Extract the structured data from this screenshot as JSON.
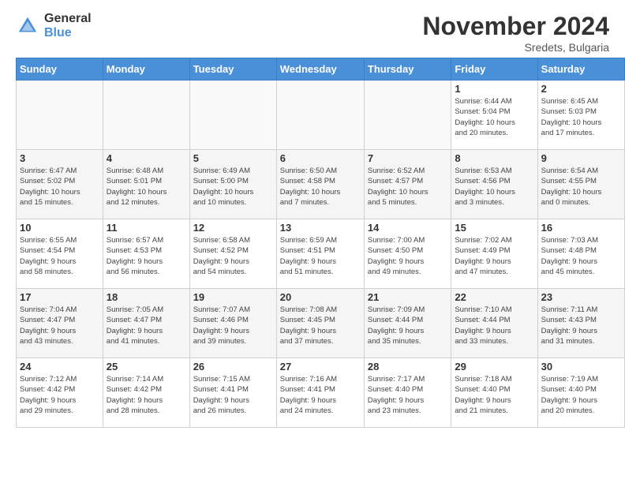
{
  "logo": {
    "general": "General",
    "blue": "Blue"
  },
  "title": "November 2024",
  "location": "Sredets, Bulgaria",
  "days_of_week": [
    "Sunday",
    "Monday",
    "Tuesday",
    "Wednesday",
    "Thursday",
    "Friday",
    "Saturday"
  ],
  "weeks": [
    {
      "days": [
        {
          "num": "",
          "info": ""
        },
        {
          "num": "",
          "info": ""
        },
        {
          "num": "",
          "info": ""
        },
        {
          "num": "",
          "info": ""
        },
        {
          "num": "",
          "info": ""
        },
        {
          "num": "1",
          "info": "Sunrise: 6:44 AM\nSunset: 5:04 PM\nDaylight: 10 hours\nand 20 minutes."
        },
        {
          "num": "2",
          "info": "Sunrise: 6:45 AM\nSunset: 5:03 PM\nDaylight: 10 hours\nand 17 minutes."
        }
      ]
    },
    {
      "days": [
        {
          "num": "3",
          "info": "Sunrise: 6:47 AM\nSunset: 5:02 PM\nDaylight: 10 hours\nand 15 minutes."
        },
        {
          "num": "4",
          "info": "Sunrise: 6:48 AM\nSunset: 5:01 PM\nDaylight: 10 hours\nand 12 minutes."
        },
        {
          "num": "5",
          "info": "Sunrise: 6:49 AM\nSunset: 5:00 PM\nDaylight: 10 hours\nand 10 minutes."
        },
        {
          "num": "6",
          "info": "Sunrise: 6:50 AM\nSunset: 4:58 PM\nDaylight: 10 hours\nand 7 minutes."
        },
        {
          "num": "7",
          "info": "Sunrise: 6:52 AM\nSunset: 4:57 PM\nDaylight: 10 hours\nand 5 minutes."
        },
        {
          "num": "8",
          "info": "Sunrise: 6:53 AM\nSunset: 4:56 PM\nDaylight: 10 hours\nand 3 minutes."
        },
        {
          "num": "9",
          "info": "Sunrise: 6:54 AM\nSunset: 4:55 PM\nDaylight: 10 hours\nand 0 minutes."
        }
      ]
    },
    {
      "days": [
        {
          "num": "10",
          "info": "Sunrise: 6:55 AM\nSunset: 4:54 PM\nDaylight: 9 hours\nand 58 minutes."
        },
        {
          "num": "11",
          "info": "Sunrise: 6:57 AM\nSunset: 4:53 PM\nDaylight: 9 hours\nand 56 minutes."
        },
        {
          "num": "12",
          "info": "Sunrise: 6:58 AM\nSunset: 4:52 PM\nDaylight: 9 hours\nand 54 minutes."
        },
        {
          "num": "13",
          "info": "Sunrise: 6:59 AM\nSunset: 4:51 PM\nDaylight: 9 hours\nand 51 minutes."
        },
        {
          "num": "14",
          "info": "Sunrise: 7:00 AM\nSunset: 4:50 PM\nDaylight: 9 hours\nand 49 minutes."
        },
        {
          "num": "15",
          "info": "Sunrise: 7:02 AM\nSunset: 4:49 PM\nDaylight: 9 hours\nand 47 minutes."
        },
        {
          "num": "16",
          "info": "Sunrise: 7:03 AM\nSunset: 4:48 PM\nDaylight: 9 hours\nand 45 minutes."
        }
      ]
    },
    {
      "days": [
        {
          "num": "17",
          "info": "Sunrise: 7:04 AM\nSunset: 4:47 PM\nDaylight: 9 hours\nand 43 minutes."
        },
        {
          "num": "18",
          "info": "Sunrise: 7:05 AM\nSunset: 4:47 PM\nDaylight: 9 hours\nand 41 minutes."
        },
        {
          "num": "19",
          "info": "Sunrise: 7:07 AM\nSunset: 4:46 PM\nDaylight: 9 hours\nand 39 minutes."
        },
        {
          "num": "20",
          "info": "Sunrise: 7:08 AM\nSunset: 4:45 PM\nDaylight: 9 hours\nand 37 minutes."
        },
        {
          "num": "21",
          "info": "Sunrise: 7:09 AM\nSunset: 4:44 PM\nDaylight: 9 hours\nand 35 minutes."
        },
        {
          "num": "22",
          "info": "Sunrise: 7:10 AM\nSunset: 4:44 PM\nDaylight: 9 hours\nand 33 minutes."
        },
        {
          "num": "23",
          "info": "Sunrise: 7:11 AM\nSunset: 4:43 PM\nDaylight: 9 hours\nand 31 minutes."
        }
      ]
    },
    {
      "days": [
        {
          "num": "24",
          "info": "Sunrise: 7:12 AM\nSunset: 4:42 PM\nDaylight: 9 hours\nand 29 minutes."
        },
        {
          "num": "25",
          "info": "Sunrise: 7:14 AM\nSunset: 4:42 PM\nDaylight: 9 hours\nand 28 minutes."
        },
        {
          "num": "26",
          "info": "Sunrise: 7:15 AM\nSunset: 4:41 PM\nDaylight: 9 hours\nand 26 minutes."
        },
        {
          "num": "27",
          "info": "Sunrise: 7:16 AM\nSunset: 4:41 PM\nDaylight: 9 hours\nand 24 minutes."
        },
        {
          "num": "28",
          "info": "Sunrise: 7:17 AM\nSunset: 4:40 PM\nDaylight: 9 hours\nand 23 minutes."
        },
        {
          "num": "29",
          "info": "Sunrise: 7:18 AM\nSunset: 4:40 PM\nDaylight: 9 hours\nand 21 minutes."
        },
        {
          "num": "30",
          "info": "Sunrise: 7:19 AM\nSunset: 4:40 PM\nDaylight: 9 hours\nand 20 minutes."
        }
      ]
    }
  ]
}
